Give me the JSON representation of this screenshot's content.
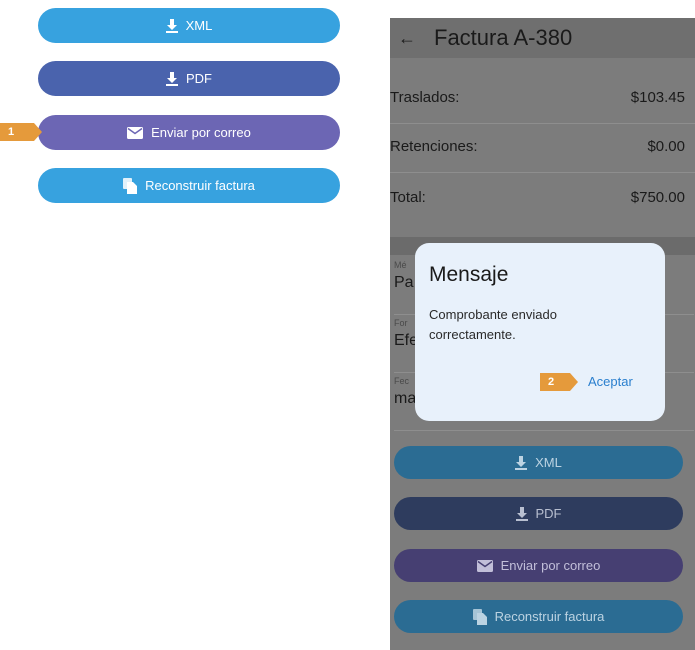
{
  "left_actions": {
    "xml_label": "XML",
    "pdf_label": "PDF",
    "email_label": "Enviar por correo",
    "rebuild_label": "Reconstruir factura"
  },
  "callouts": {
    "step1": "1",
    "step2": "2"
  },
  "phone": {
    "title": "Factura A-380",
    "back_icon": "arrow-left-icon",
    "rows": [
      {
        "label": "Traslados:",
        "value": "$103.45"
      },
      {
        "label": "Retenciones:",
        "value": "$0.00"
      },
      {
        "label": "Total:",
        "value": "$750.00"
      }
    ],
    "fields": [
      {
        "label": "Mé",
        "value": "Pa"
      },
      {
        "label": "For",
        "value": "Efe"
      },
      {
        "label": "Fec",
        "value": "ma"
      }
    ],
    "buttons": {
      "xml_label": "XML",
      "pdf_label": "PDF",
      "email_label": "Enviar por correo",
      "rebuild_label": "Reconstruir factura"
    }
  },
  "dialog": {
    "title": "Mensaje",
    "message": "Comprobante enviado correctamente.",
    "accept_label": "Aceptar"
  },
  "colors": {
    "xml_button": "#37a2df",
    "pdf_button": "#4a63ad",
    "email_button": "#6c66b4",
    "rebuild_button": "#37a2df",
    "callout": "#e59a3b",
    "dialog_bg": "#e8f1fb",
    "accept_text": "#2a7fce"
  }
}
